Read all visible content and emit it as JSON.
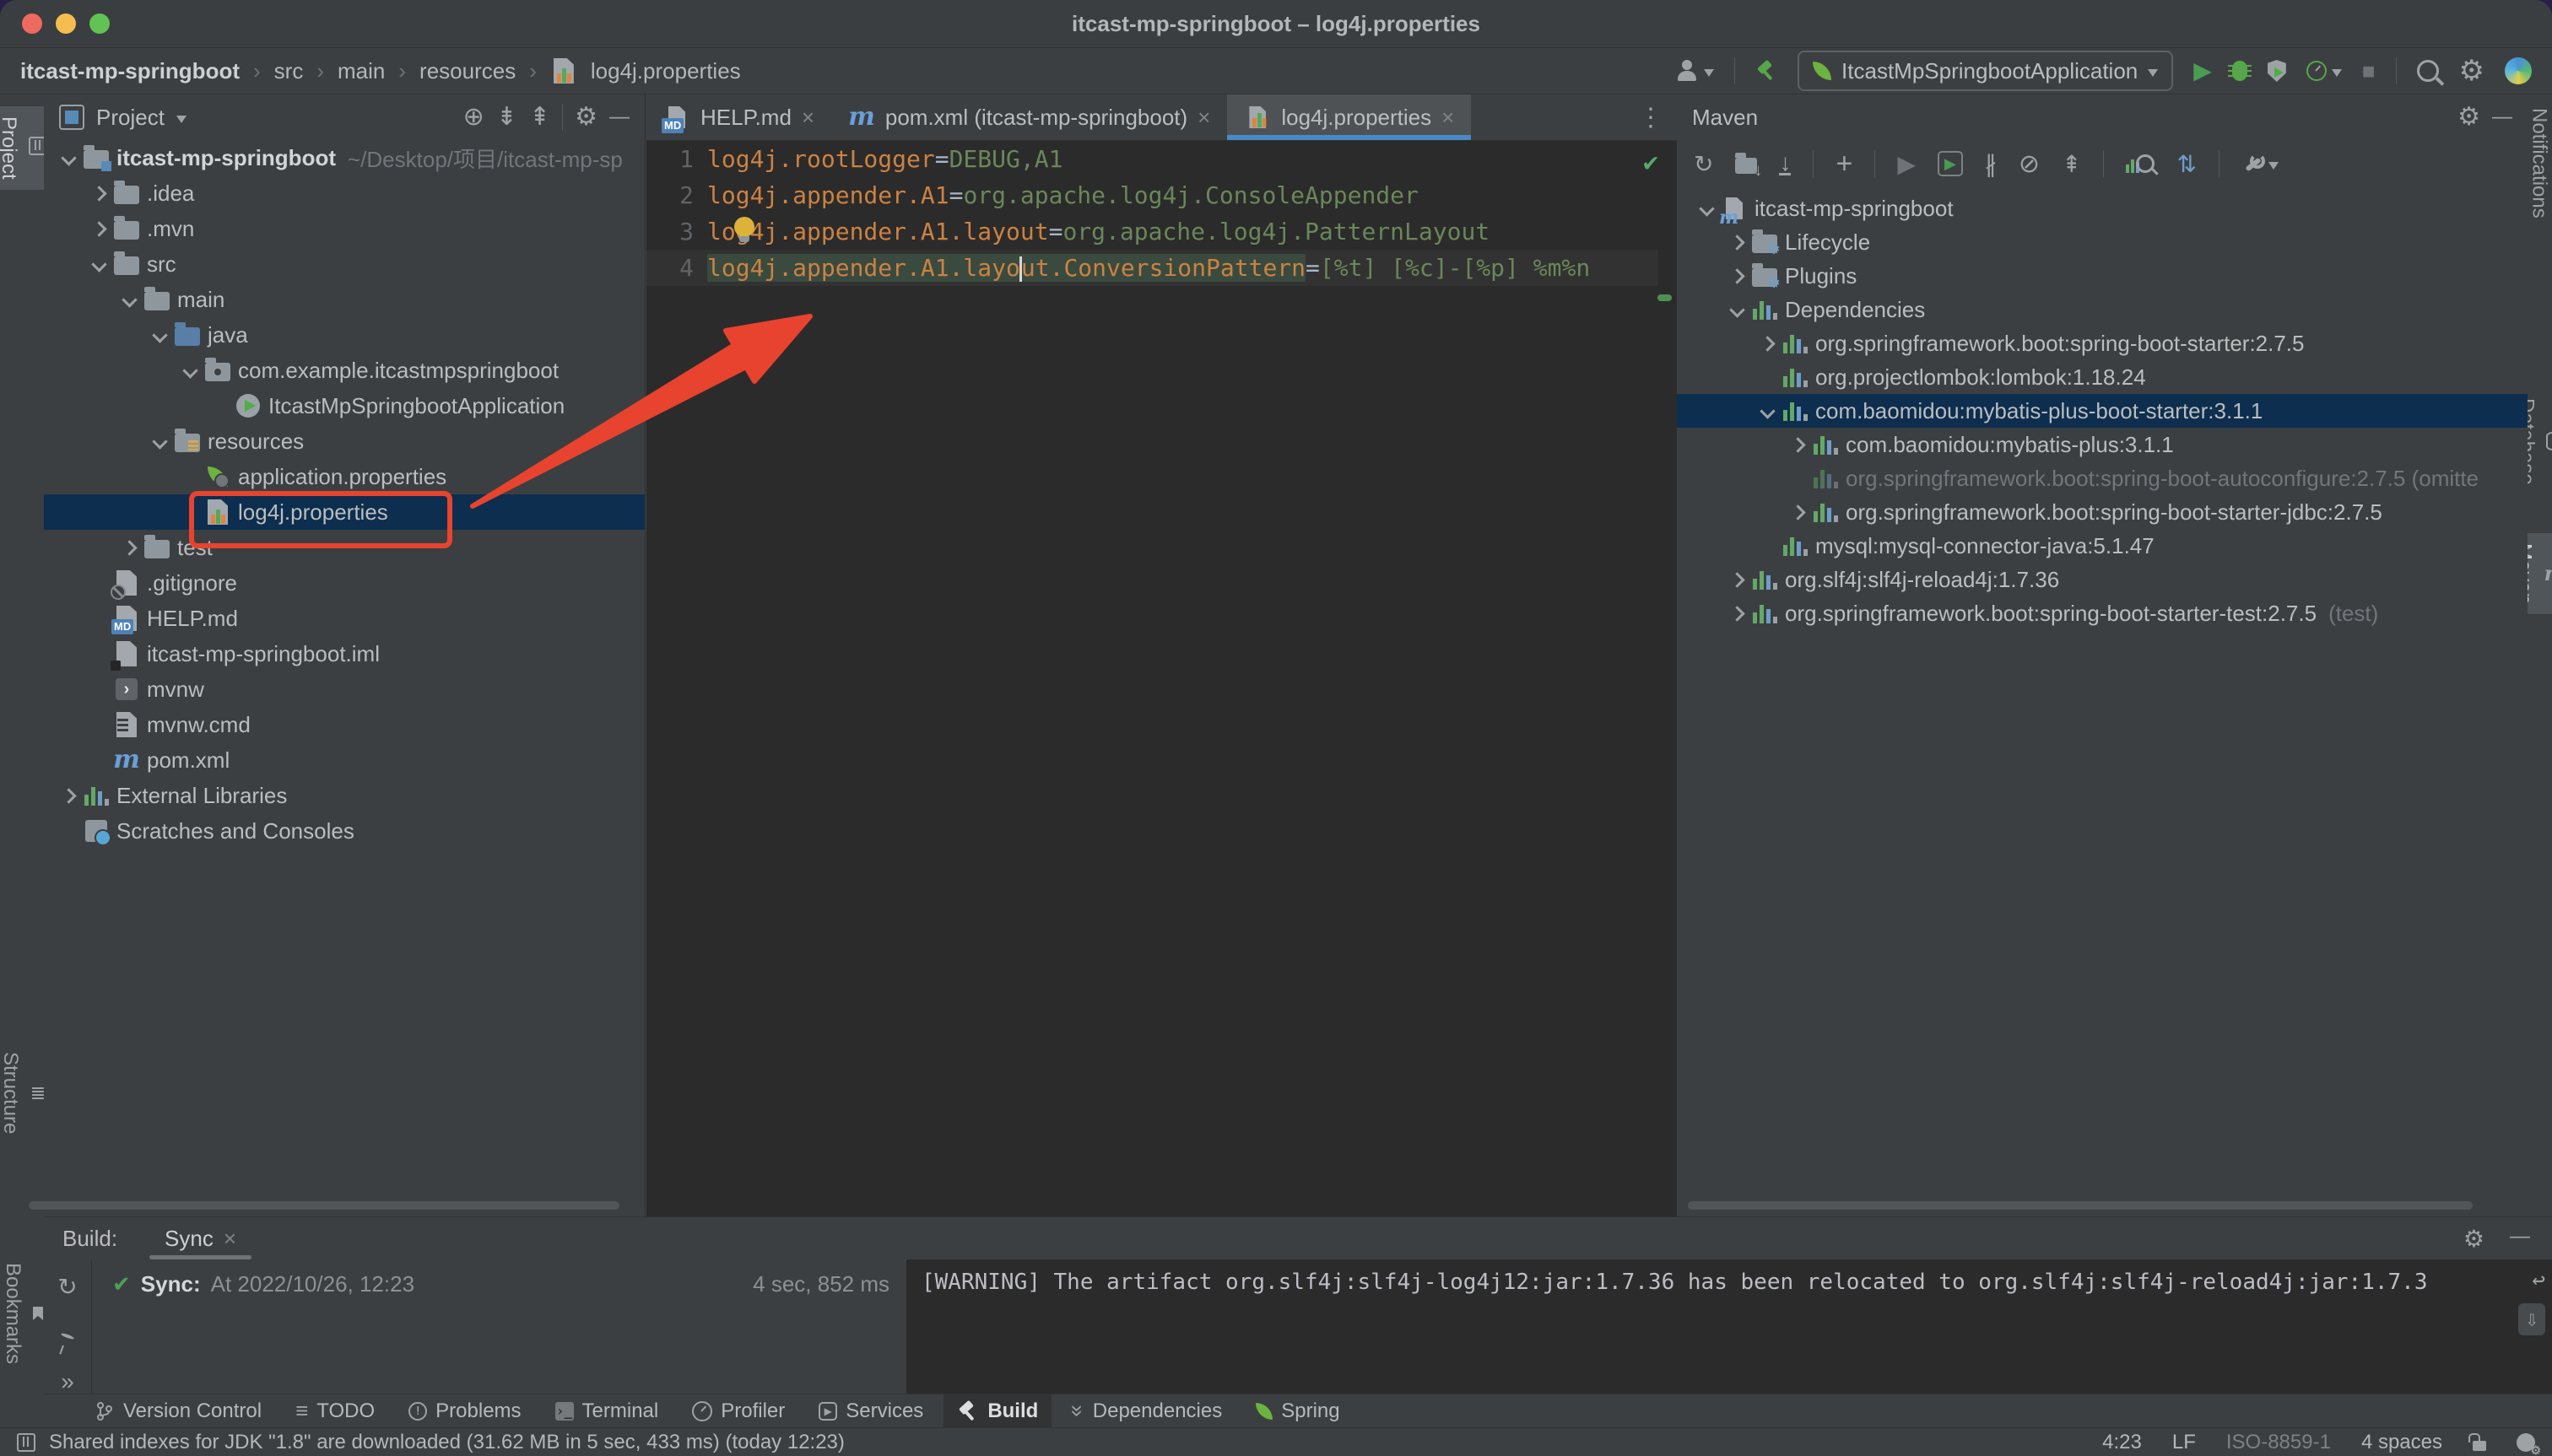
{
  "window": {
    "title": "itcast-mp-springboot – log4j.properties"
  },
  "colors": {
    "accent_red": "#e8432e",
    "selection_navy": "#0d2e4e",
    "tab_underline_blue": "#4a88c7",
    "key_orange": "#cc8242",
    "value_green": "#6a8759",
    "check_green": "#59a869",
    "traffic_close": "#ee6a5f",
    "traffic_min": "#f5bd4f",
    "traffic_zoom": "#61c354"
  },
  "icons": {
    "gear": "⚙",
    "minus": "—",
    "more_v": "⋮",
    "more_h": "»",
    "plus": "+",
    "target": "⊕",
    "expand_all": "⇟",
    "collapse_all": "⇞",
    "sync": "↻",
    "play": "▶",
    "stop": "■",
    "offline": "⊘",
    "skip_tests": "∦",
    "updown": "⇅",
    "down_arrow": "↓",
    "caret_down": "▾",
    "check": "✔",
    "crumb_sep": "›",
    "todo": "≡",
    "excl": "!",
    "terminal_glyph": "›_",
    "wrap": "↩",
    "scroll_end": "⇩",
    "m_letter": "m",
    "chev_double_down": "»"
  },
  "breadcrumbs": {
    "items": [
      "itcast-mp-springboot",
      "src",
      "main",
      "resources",
      "log4j.properties"
    ]
  },
  "toolbar": {
    "run_config": "ItcastMpSpringbootApplication"
  },
  "left_stripe": {
    "items": [
      {
        "label": "Project"
      },
      {
        "label": "Structure"
      },
      {
        "label": "Bookmarks"
      }
    ]
  },
  "right_stripe": {
    "items": [
      {
        "label": "Notifications"
      },
      {
        "label": "Database"
      },
      {
        "label": "Maven"
      }
    ]
  },
  "project": {
    "title": "Project",
    "tree": [
      {
        "label": "itcast-mp-springboot",
        "sub": "~/Desktop/项目/itcast-mp-sp"
      },
      {
        "label": ".idea"
      },
      {
        "label": ".mvn"
      },
      {
        "label": "src"
      },
      {
        "label": "main"
      },
      {
        "label": "java"
      },
      {
        "label": "com.example.itcastmpspringboot"
      },
      {
        "label": "ItcastMpSpringbootApplication"
      },
      {
        "label": "resources"
      },
      {
        "label": "application.properties"
      },
      {
        "label": "log4j.properties"
      },
      {
        "label": "test"
      },
      {
        "label": ".gitignore"
      },
      {
        "label": "HELP.md"
      },
      {
        "label": "itcast-mp-springboot.iml"
      },
      {
        "label": "mvnw"
      },
      {
        "label": "mvnw.cmd"
      },
      {
        "label": "pom.xml"
      },
      {
        "label": "External Libraries"
      },
      {
        "label": "Scratches and Consoles"
      }
    ]
  },
  "editor": {
    "tabs": [
      {
        "label": "HELP.md",
        "close": "×"
      },
      {
        "label": "pom.xml (itcast-mp-springboot)",
        "close": "×"
      },
      {
        "label": "log4j.properties",
        "close": "×"
      }
    ],
    "line_numbers": [
      "1",
      "2",
      "3",
      "4"
    ],
    "lines": [
      {
        "key": "log4j.rootLogger",
        "eq": "=",
        "value": "DEBUG,A1"
      },
      {
        "key": "log4j.appender.A1",
        "eq": "=",
        "value": "org.apache.log4j.ConsoleAppender"
      },
      {
        "key": "log4j.appender.A1.layout",
        "eq": "=",
        "value": "org.apache.log4j.PatternLayout"
      },
      {
        "key_a": "log4j.appender.A1.layo",
        "key_b": "ut.ConversionPattern",
        "eq": "=",
        "value": "[%t] [%c]-[%p] %m%n"
      }
    ]
  },
  "maven": {
    "title": "Maven",
    "tree": [
      {
        "label": "itcast-mp-springboot"
      },
      {
        "label": "Lifecycle"
      },
      {
        "label": "Plugins"
      },
      {
        "label": "Dependencies"
      },
      {
        "label": "org.springframework.boot:spring-boot-starter:2.7.5"
      },
      {
        "label": "org.projectlombok:lombok:1.18.24"
      },
      {
        "label": "com.baomidou:mybatis-plus-boot-starter:3.1.1"
      },
      {
        "label": "com.baomidou:mybatis-plus:3.1.1"
      },
      {
        "label": "org.springframework.boot:spring-boot-autoconfigure:2.7.5 (omitte"
      },
      {
        "label": "org.springframework.boot:spring-boot-starter-jdbc:2.7.5"
      },
      {
        "label": "mysql:mysql-connector-java:5.1.47"
      },
      {
        "label": "org.slf4j:slf4j-reload4j:1.7.36"
      },
      {
        "label": "org.springframework.boot:spring-boot-starter-test:2.7.5",
        "suffix": "(test)"
      }
    ]
  },
  "build": {
    "label": "Build:",
    "tab": "Sync",
    "tab_close": "×",
    "sync_title": "Sync:",
    "sync_text": "At 2022/10/26, 12:23",
    "duration": "4 sec, 852 ms",
    "console": "[WARNING] The artifact org.slf4j:slf4j-log4j12:jar:1.7.36 has been relocated to org.slf4j:slf4j-reload4j:jar:1.7.3"
  },
  "bottom_bar": {
    "items": [
      {
        "label": "Version Control"
      },
      {
        "label": "TODO"
      },
      {
        "label": "Problems"
      },
      {
        "label": "Terminal"
      },
      {
        "label": "Profiler"
      },
      {
        "label": "Services"
      },
      {
        "label": "Build"
      },
      {
        "label": "Dependencies"
      },
      {
        "label": "Spring"
      }
    ]
  },
  "status_bar": {
    "message": "Shared indexes for JDK \"1.8\" are downloaded (31.62 MB in 5 sec, 433 ms) (today 12:23)",
    "caret": "4:23",
    "line_sep": "LF",
    "encoding": "ISO-8859-1",
    "indent": "4 spaces"
  }
}
